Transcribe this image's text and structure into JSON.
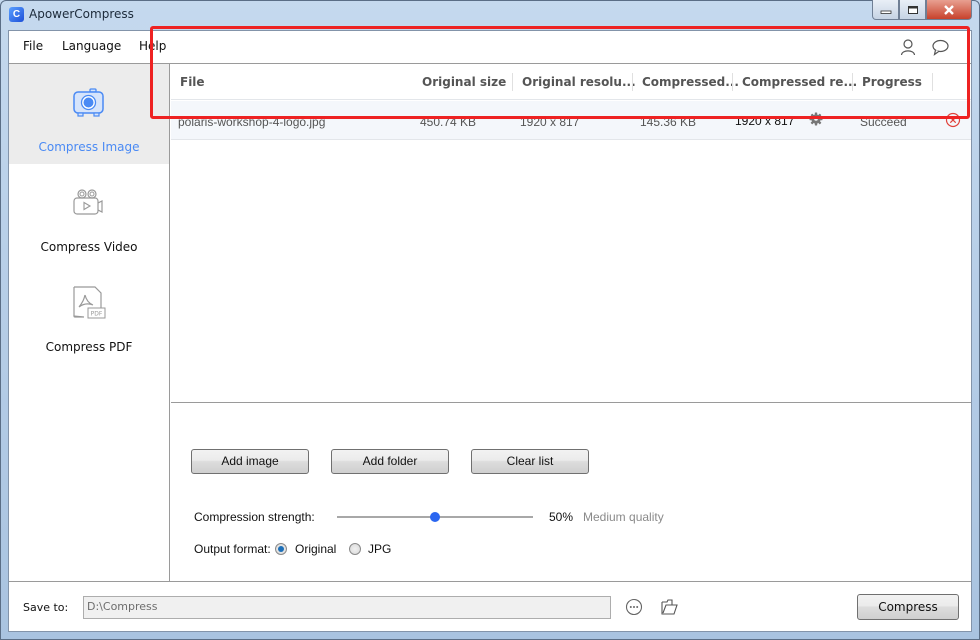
{
  "window": {
    "title": "ApowerCompress",
    "app_icon_glyph": "C",
    "controls": {
      "minimize": "—",
      "maximize": "□",
      "close": "✕"
    }
  },
  "menu": {
    "items": [
      {
        "label": "File"
      },
      {
        "label": "Language"
      },
      {
        "label": "Help"
      }
    ],
    "right_icons": [
      "user-icon",
      "chat-icon"
    ]
  },
  "sidebar": {
    "items": [
      {
        "label": "Compress Image",
        "icon": "camera-icon",
        "active": true
      },
      {
        "label": "Compress Video",
        "icon": "video-camera-icon",
        "active": false
      },
      {
        "label": "Compress PDF",
        "icon": "pdf-file-icon",
        "active": false
      }
    ]
  },
  "table": {
    "headers": [
      "File",
      "Original size",
      "Original resolu...",
      "Compressed...",
      "Compressed re...",
      "Progress"
    ],
    "rows": [
      {
        "file": "polaris-workshop-4-logo.jpg",
        "original_size": "450.74 KB",
        "original_resolution": "1920 x 817",
        "compressed_size": "145.36 KB",
        "compressed_resolution": "1920 x 817",
        "progress": "Succeed"
      }
    ]
  },
  "controls": {
    "add_image": "Add image",
    "add_folder": "Add folder",
    "clear_list": "Clear list",
    "compression_label": "Compression strength:",
    "compression_value_percent": 50,
    "compression_value_text": "50%",
    "quality_text": "Medium quality",
    "output_format_label": "Output format:",
    "format_options": [
      {
        "label": "Original",
        "checked": true
      },
      {
        "label": "JPG",
        "checked": false
      }
    ]
  },
  "footer": {
    "save_to_label": "Save to:",
    "save_path": "D:\\Compress",
    "compress_button": "Compress"
  },
  "colors": {
    "accent": "#4a8af4",
    "slider_thumb": "#2a66f0",
    "highlight_box": "#ee2222",
    "remove_icon": "#e0413a"
  }
}
